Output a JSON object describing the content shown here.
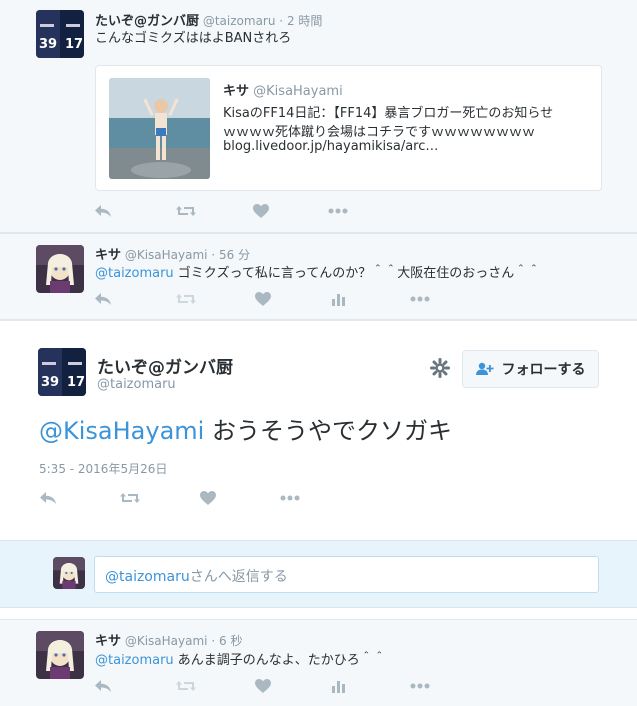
{
  "tweet1": {
    "name": "たいぞ@ガンバ厨",
    "handle": "@taizomaru",
    "sep": "·",
    "time": "2 時間",
    "text": "こんなゴミクズははよBANされろ",
    "card": {
      "name": "キサ",
      "handle": "@KisaHayami",
      "line1": "KisaのFF14日記：【FF14】暴言ブロガー死亡のお知らせ",
      "line2": "ｗｗｗｗ死体蹴り会場はコチラですｗｗｗｗｗｗｗｗ",
      "line3": "blog.livedoor.jp/hayamikisa/arc…"
    }
  },
  "tweet2": {
    "name": "キサ",
    "handle": "@KisaHayami",
    "sep": "·",
    "time": "56 分",
    "mention": "@taizomaru",
    "text": " ゴミクズって私に言ってんのか？＾＾大阪在住のおっさん＾＾"
  },
  "main": {
    "name": "たいぞ@ガンバ厨",
    "handle": "@taizomaru",
    "follow_label": "フォローする",
    "mention": "@KisaHayami",
    "text": " おうそうやでクソガキ",
    "timestamp": "5:35 - 2016年5月26日"
  },
  "reply": {
    "mention": "@taizomaru",
    "placeholder_rest": "さんへ返信する"
  },
  "tweet3": {
    "name": "キサ",
    "handle": "@KisaHayami",
    "sep": "·",
    "time": "6 秒",
    "mention": "@taizomaru",
    "text": " あんま調子のんなよ、たかひろ＾＾"
  },
  "colors": {
    "link": "#3b94d9",
    "muted": "#8899a6",
    "icon": "#aab8c2",
    "reply_bg": "#e8f4fb"
  }
}
